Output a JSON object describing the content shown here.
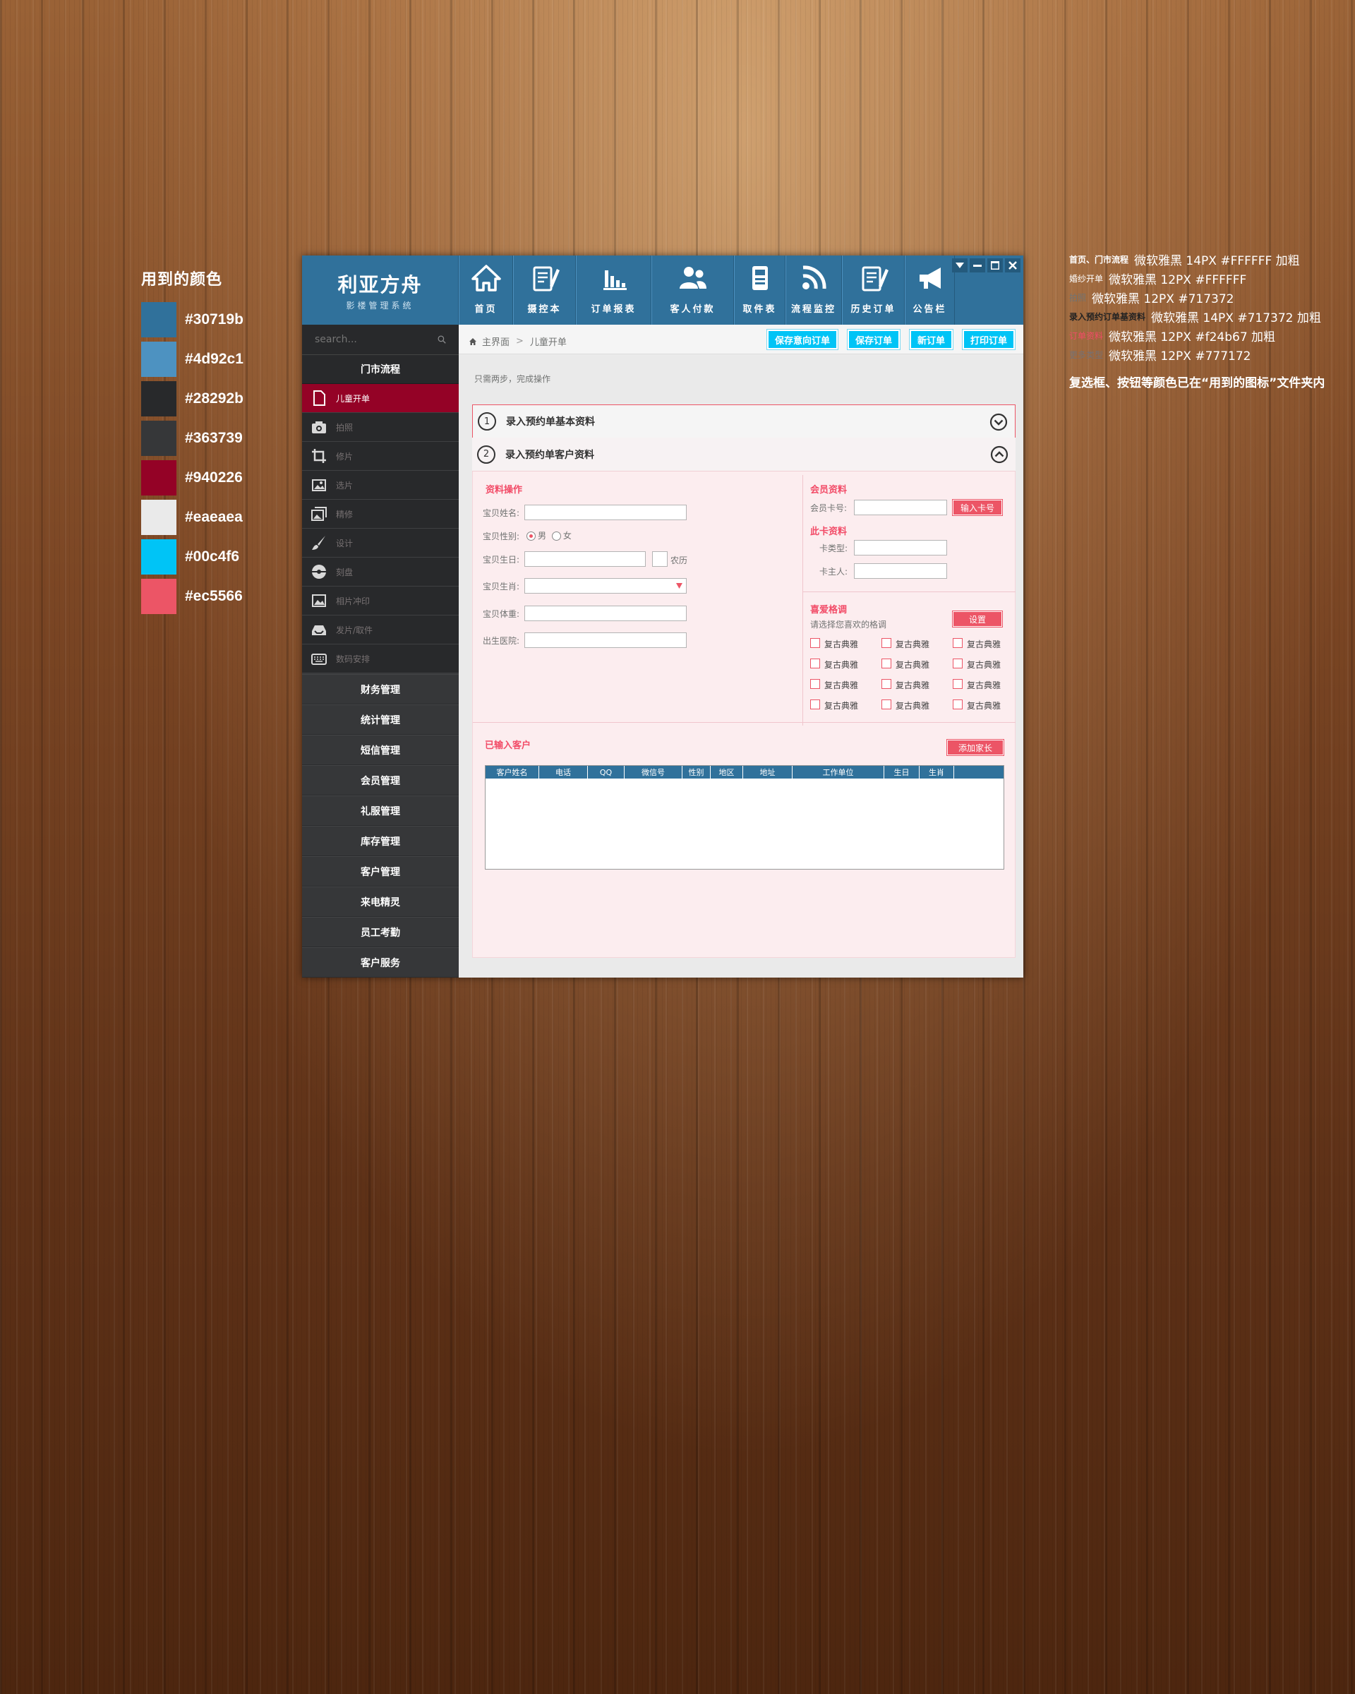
{
  "palette": {
    "title": "用到的颜色",
    "colors": [
      {
        "hex": "#30719b",
        "label": "#30719b"
      },
      {
        "hex": "#4d92c1",
        "label": "#4d92c1"
      },
      {
        "hex": "#28292b",
        "label": "#28292b"
      },
      {
        "hex": "#363739",
        "label": "#363739"
      },
      {
        "hex": "#940226",
        "label": "#940226"
      },
      {
        "hex": "#eaeaea",
        "label": "#eaeaea"
      },
      {
        "hex": "#00c4f6",
        "label": "#00c4f6"
      },
      {
        "hex": "#ec5566",
        "label": "#ec5566"
      }
    ]
  },
  "notes": {
    "rows": [
      {
        "sample": "首页、门市流程",
        "sample_color": "#FFFFFF",
        "desc": "微软雅黑 14PX #FFFFFF 加粗"
      },
      {
        "sample": "婚纱开单",
        "sample_color": "#FFFFFF",
        "desc": "微软雅黑 12PX #FFFFFF"
      },
      {
        "sample": "拍照",
        "sample_color": "#717372",
        "desc": "微软雅黑 12PX #717372"
      },
      {
        "sample": "录入预约订单基资料",
        "sample_color": "#222222",
        "desc": "微软雅黑 14PX #717372 加粗"
      },
      {
        "sample": "订单资料",
        "sample_color": "#f24b67",
        "desc": "微软雅黑 12PX #f24b67 加粗"
      },
      {
        "sample": "更多类型",
        "sample_color": "#777172",
        "desc": "微软雅黑 12PX #777172"
      }
    ],
    "extra": "复选框、按钮等颜色已在“用到的图标”文件夹内"
  },
  "app": {
    "logo_main": "利亚方舟",
    "logo_sub": "影楼管理系统",
    "nav": [
      {
        "label": "首页",
        "icon": "home-icon"
      },
      {
        "label": "摄控本",
        "icon": "notebook-icon"
      },
      {
        "label": "订单报表",
        "icon": "bar-chart-icon"
      },
      {
        "label": "客人付款",
        "icon": "users-icon"
      },
      {
        "label": "取件表",
        "icon": "document-icon"
      },
      {
        "label": "流程监控",
        "icon": "signal-icon"
      },
      {
        "label": "历史订单",
        "icon": "history-icon"
      },
      {
        "label": "公告栏",
        "icon": "megaphone-icon"
      }
    ]
  },
  "sidebar": {
    "search_placeholder": "search...",
    "section": "门市流程",
    "sub_items": [
      {
        "label": "儿童开单",
        "icon": "file-icon",
        "active": true
      },
      {
        "label": "拍照",
        "icon": "camera-icon"
      },
      {
        "label": "修片",
        "icon": "crop-icon"
      },
      {
        "label": "选片",
        "icon": "picture-icon"
      },
      {
        "label": "精修",
        "icon": "gallery-icon"
      },
      {
        "label": "设计",
        "icon": "brush-icon"
      },
      {
        "label": "刻盘",
        "icon": "disc-icon"
      },
      {
        "label": "相片冲印",
        "icon": "photo-print-icon"
      },
      {
        "label": "发片/取件",
        "icon": "tray-icon"
      },
      {
        "label": "数码安排",
        "icon": "keyboard-icon"
      }
    ],
    "menu": [
      "财务管理",
      "统计管理",
      "短信管理",
      "会员管理",
      "礼服管理",
      "库存管理",
      "客户管理",
      "来电精灵",
      "员工考勤",
      "客户服务"
    ]
  },
  "toolbar": {
    "breadcrumb_home": "主界面",
    "breadcrumb_current": "儿童开单",
    "buttons": [
      "保存意向订单",
      "保存订单",
      "新订单",
      "打印订单"
    ]
  },
  "main": {
    "hint": "只需两步，完成操作",
    "step1": {
      "num": "1",
      "title": "录入预约单基本资料"
    },
    "step2": {
      "num": "2",
      "title": "录入预约单客户资料"
    }
  },
  "form": {
    "section_title": "资料操作",
    "name_label": "宝贝姓名:",
    "gender_label": "宝贝性别:",
    "gender_male": "男",
    "gender_female": "女",
    "birthday_label": "宝贝生日:",
    "lunar_label": "农历",
    "zodiac_label": "宝贝生肖:",
    "weight_label": "宝贝体重:",
    "hospital_label": "出生医院:"
  },
  "member": {
    "title": "会员资料",
    "card_no_label": "会员卡号:",
    "input_card_button": "输入卡号",
    "card_info_title": "此卡资料",
    "card_type_label": "卡类型:",
    "card_owner_label": "卡主人:"
  },
  "style_pref": {
    "title": "喜爱格调",
    "subtitle": "请选择您喜欢的格调",
    "set_button": "设置",
    "options": [
      "复古典雅",
      "复古典雅",
      "复古典雅",
      "复古典雅",
      "复古典雅",
      "复古典雅",
      "复古典雅",
      "复古典雅",
      "复古典雅",
      "复古典雅",
      "复古典雅",
      "复古典雅"
    ]
  },
  "customers": {
    "title": "已输入客户",
    "add_parent_button": "添加家长",
    "columns": [
      "客户姓名",
      "电话",
      "QQ",
      "微信号",
      "性别",
      "地区",
      "地址",
      "工作单位",
      "生日",
      "生肖"
    ]
  }
}
